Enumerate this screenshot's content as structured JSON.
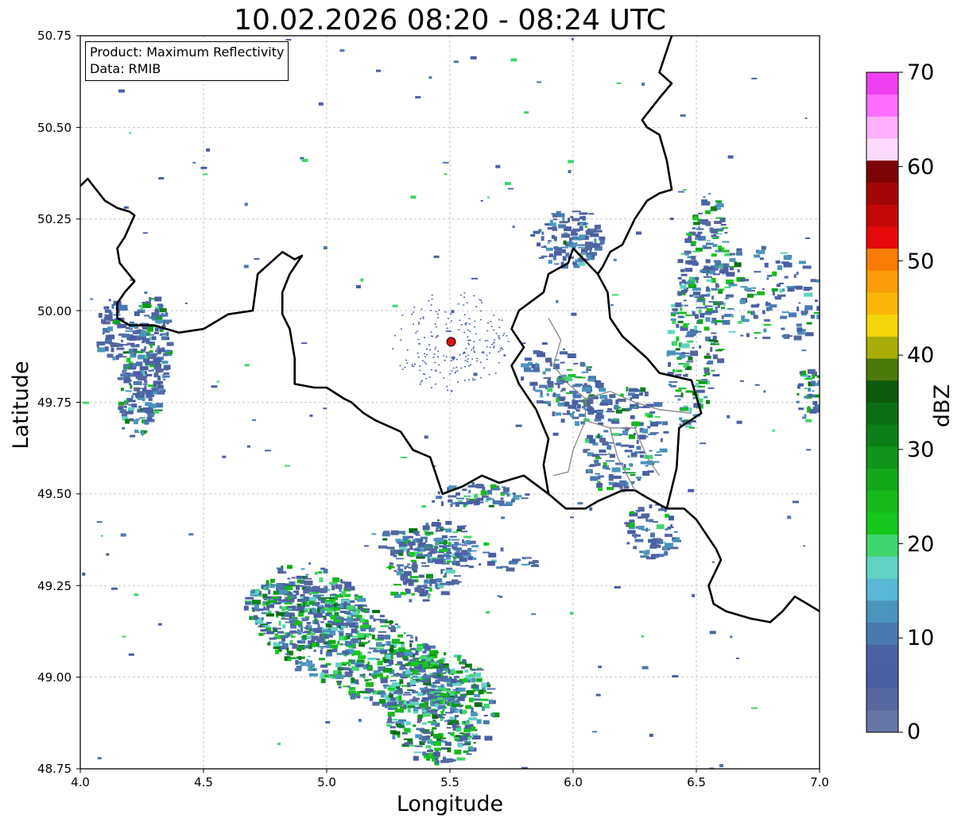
{
  "title": "10.02.2026 08:20 - 08:24 UTC",
  "info_box": {
    "line1": "Product: Maximum Reflectivity",
    "line2": "Data: RMIB"
  },
  "axes": {
    "xlabel": "Longitude",
    "ylabel": "Latitude",
    "xlim": [
      4.0,
      7.0
    ],
    "ylim": [
      48.75,
      50.75
    ],
    "xticks": [
      "4.0",
      "4.5",
      "5.0",
      "5.5",
      "6.0",
      "6.5",
      "7.0"
    ],
    "yticks": [
      "50.75",
      "50.50",
      "50.25",
      "50.00",
      "49.75",
      "49.50",
      "49.25",
      "49.00",
      "48.75"
    ],
    "grid": true
  },
  "colorbar": {
    "label": "dBZ",
    "ticks": [
      "0",
      "10",
      "20",
      "30",
      "40",
      "50",
      "60",
      "70"
    ],
    "range": [
      0,
      70
    ],
    "colors": [
      "#6676a6",
      "#56679f",
      "#4a5ea3",
      "#4a62a4",
      "#4a78b0",
      "#4a95bd",
      "#5ab7d6",
      "#5fd3c4",
      "#3fd66e",
      "#16c81e",
      "#17ba1c",
      "#12a81a",
      "#0f951a",
      "#0d7f18",
      "#0a6e15",
      "#0c5a0c",
      "#4a7a0a",
      "#a8ad09",
      "#f5d60a",
      "#fab606",
      "#f99c06",
      "#f87c06",
      "#e50a0a",
      "#c20808",
      "#a20606",
      "#7d0404",
      "#ffdaff",
      "#ffb0fb",
      "#fe6dfe",
      "#f03ff0"
    ]
  },
  "radar_site": {
    "lon": 5.505,
    "lat": 49.915,
    "color": "#e01010"
  },
  "chart_data": {
    "type": "map",
    "product": "Maximum Reflectivity",
    "units": "dBZ",
    "precip_regions": [
      {
        "region": "southwest band",
        "lon_range": [
          4.65,
          5.75
        ],
        "lat_range": [
          48.75,
          49.55
        ],
        "max_dbz": 32
      },
      {
        "region": "west cells",
        "lon_range": [
          4.05,
          4.4
        ],
        "lat_range": [
          49.6,
          50.05
        ],
        "max_dbz": 20
      },
      {
        "region": "east band",
        "lon_range": [
          6.3,
          7.0
        ],
        "lat_range": [
          49.6,
          50.3
        ],
        "max_dbz": 25
      },
      {
        "region": "central-east scattered",
        "lon_range": [
          5.75,
          6.5
        ],
        "lat_range": [
          49.25,
          50.3
        ],
        "max_dbz": 22
      }
    ]
  }
}
